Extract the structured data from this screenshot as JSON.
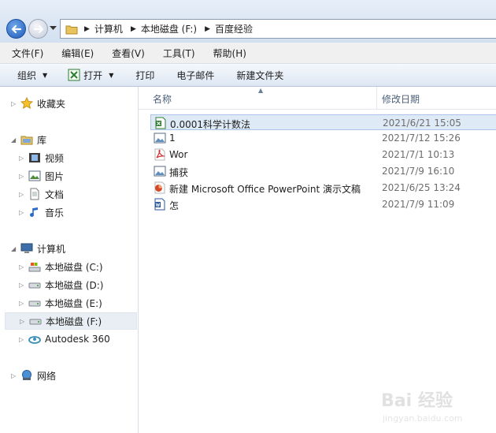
{
  "breadcrumbs": [
    "计算机",
    "本地磁盘 (F:)",
    "百度经验"
  ],
  "menu": [
    "文件(F)",
    "编辑(E)",
    "查看(V)",
    "工具(T)",
    "帮助(H)"
  ],
  "toolbar": {
    "organize": "组织",
    "open": "打开",
    "print": "打印",
    "email": "电子邮件",
    "new_folder": "新建文件夹"
  },
  "nav": {
    "favorites": "收藏夹",
    "libraries": "库",
    "library_items": [
      "视频",
      "图片",
      "文档",
      "音乐"
    ],
    "computer": "计算机",
    "drives": [
      "本地磁盘 (C:)",
      "本地磁盘 (D:)",
      "本地磁盘 (E:)",
      "本地磁盘 (F:)",
      "Autodesk 360"
    ],
    "network": "网络"
  },
  "columns": {
    "name": "名称",
    "modified": "修改日期"
  },
  "files": [
    {
      "name": "0.0001科学计数法",
      "date": "2021/6/21 15:05",
      "icon": "excel-icon"
    },
    {
      "name": "1",
      "date": "2021/7/12 15:26",
      "icon": "image-icon"
    },
    {
      "name": "Wor",
      "date": "2021/7/1 10:13",
      "icon": "pdf-icon"
    },
    {
      "name": "捕获",
      "date": "2021/7/9 16:10",
      "icon": "image-icon"
    },
    {
      "name": "新建 Microsoft Office PowerPoint 演示文稿",
      "date": "2021/6/25 13:24",
      "icon": "powerpoint-icon"
    },
    {
      "name": "怎",
      "date": "2021/7/9 11:09",
      "icon": "word-icon"
    }
  ],
  "watermark": {
    "brand": "Bai 经验",
    "url": "jingyan.baidu.com"
  },
  "colors": {
    "selection": "#dfeaf7",
    "nav_bg": "#d3e0f0",
    "accent": "#1d5bb8"
  }
}
